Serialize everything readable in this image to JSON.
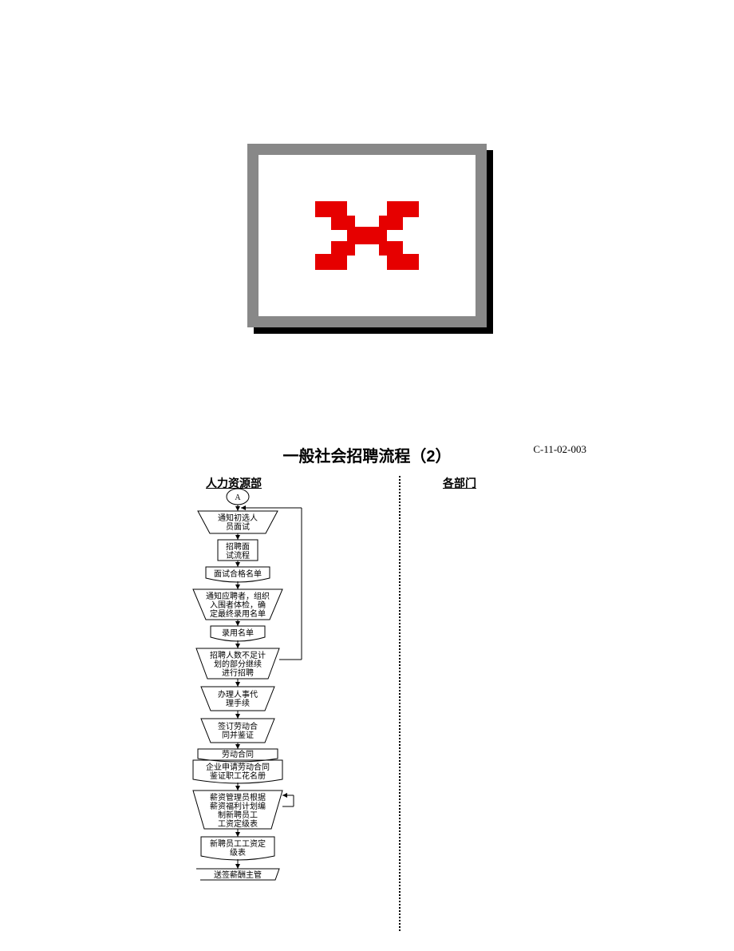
{
  "doc_number": "C-11-02-003",
  "title": "一般社会招聘流程（2）",
  "lanes": {
    "hr": "人力资源部",
    "dept": "各部门"
  },
  "flow": {
    "start": "A",
    "n1": [
      "通知初选人",
      "员面试"
    ],
    "n2": [
      "招聘面",
      "试流程"
    ],
    "n3": "面试合格名单",
    "n4": [
      "通知应聘者，组织",
      "入围者体检，确",
      "定最终录用名单"
    ],
    "n5": "录用名单",
    "n6": [
      "招聘人数不足计",
      "划的部分继续",
      "进行招聘"
    ],
    "n7": [
      "办理人事代",
      "理手续"
    ],
    "n8": [
      "签订劳动合",
      "同并鉴证"
    ],
    "n9a": "劳动合同",
    "n9b": [
      "企业申请劳动合同",
      "鉴证职工花名册"
    ],
    "n10": [
      "薪资管理员根据",
      "薪资福利计划编",
      "制新聘员工",
      "工资定级表"
    ],
    "n11": [
      "新聘员工工资定",
      "级表"
    ],
    "n12": "送签薪酬主管"
  }
}
